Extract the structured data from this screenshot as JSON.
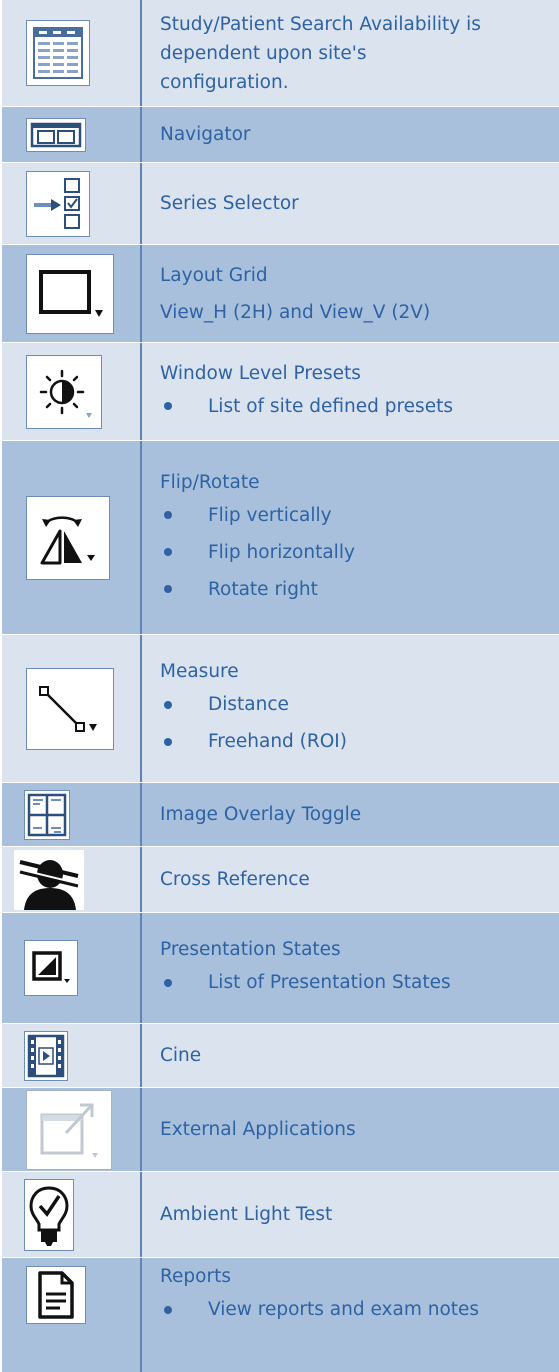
{
  "rows": [
    {
      "icon": "study-search-icon",
      "lines": [
        "Study/Patient Search Availability is",
        "dependent upon site's",
        "configuration."
      ]
    },
    {
      "icon": "navigator-icon",
      "title": "Navigator"
    },
    {
      "icon": "series-selector-icon",
      "title": "Series Selector"
    },
    {
      "icon": "layout-grid-icon",
      "title": "Layout Grid",
      "subtitle": "View_H (2H) and View_V (2V)"
    },
    {
      "icon": "window-level-icon",
      "title": "Window Level Presets",
      "bullets": [
        "List of site defined presets"
      ]
    },
    {
      "icon": "flip-rotate-icon",
      "title": "Flip/Rotate",
      "bullets": [
        "Flip vertically",
        "Flip horizontally",
        "Rotate right"
      ]
    },
    {
      "icon": "measure-icon",
      "title": "Measure",
      "bullets": [
        "Distance",
        "Freehand (ROI)"
      ]
    },
    {
      "icon": "image-overlay-icon",
      "title": "Image Overlay Toggle"
    },
    {
      "icon": "cross-reference-icon",
      "title": "Cross Reference"
    },
    {
      "icon": "presentation-states-icon",
      "title": "Presentation States",
      "bullets": [
        "List of Presentation States"
      ]
    },
    {
      "icon": "cine-icon",
      "title": "Cine"
    },
    {
      "icon": "external-applications-icon",
      "title": "External Applications"
    },
    {
      "icon": "ambient-light-icon",
      "title": "Ambient Light Test"
    },
    {
      "icon": "reports-icon",
      "title": "Reports",
      "bullets": [
        "View reports and exam notes"
      ]
    }
  ]
}
